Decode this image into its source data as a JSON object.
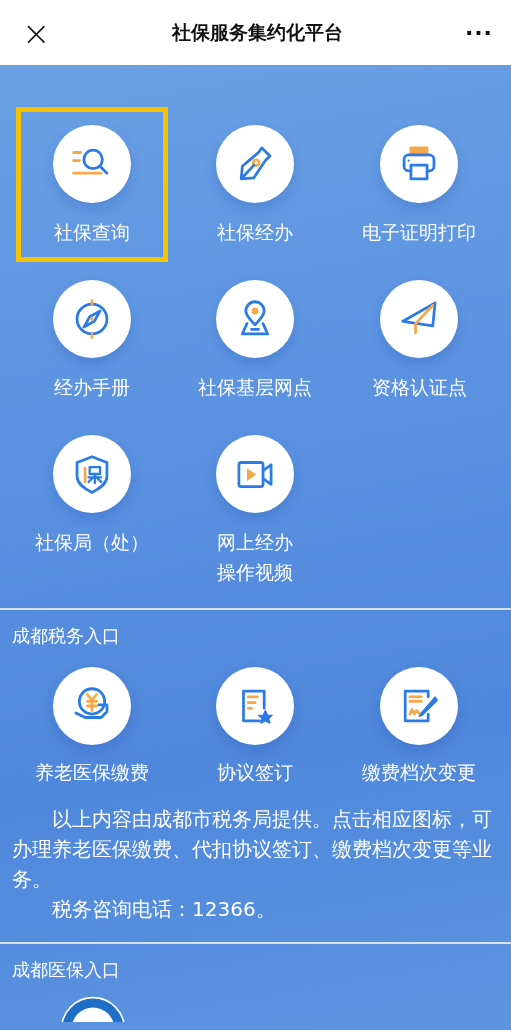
{
  "top_bar": {
    "close": "×",
    "title": "社保服务集约化平台",
    "more": "···"
  },
  "services": [
    {
      "label": "社保查询",
      "kind": "search",
      "highlighted": true
    },
    {
      "label": "社保经办",
      "kind": "pen",
      "highlighted": false
    },
    {
      "label": "电子证明打印",
      "kind": "printer",
      "highlighted": false
    },
    {
      "label": "经办手册",
      "kind": "compass",
      "highlighted": false
    },
    {
      "label": "社保基层网点",
      "kind": "location",
      "highlighted": false
    },
    {
      "label": "资格认证点",
      "kind": "send",
      "highlighted": false
    },
    {
      "label": "社保局（处）",
      "kind": "shield",
      "highlighted": false
    },
    {
      "label": "网上经办操作视频",
      "kind": "video",
      "highlighted": false
    }
  ],
  "tax_section": {
    "title": "成都税务入口",
    "items": [
      {
        "label": "养老医保缴费",
        "kind": "coin",
        "highlighted": false
      },
      {
        "label": "协议签订",
        "kind": "agreement",
        "highlighted": false
      },
      {
        "label": "缴费档次变更",
        "kind": "signature",
        "highlighted": false
      }
    ],
    "paragraphs": [
      "以上内容由成都市税务局提供。点击相应图标，可办理养老医保缴费、代扣协议签订、缴费档次变更等业务。",
      "税务咨询电话：12366。"
    ]
  },
  "medical_section": {
    "title": "成都医保入口"
  }
}
